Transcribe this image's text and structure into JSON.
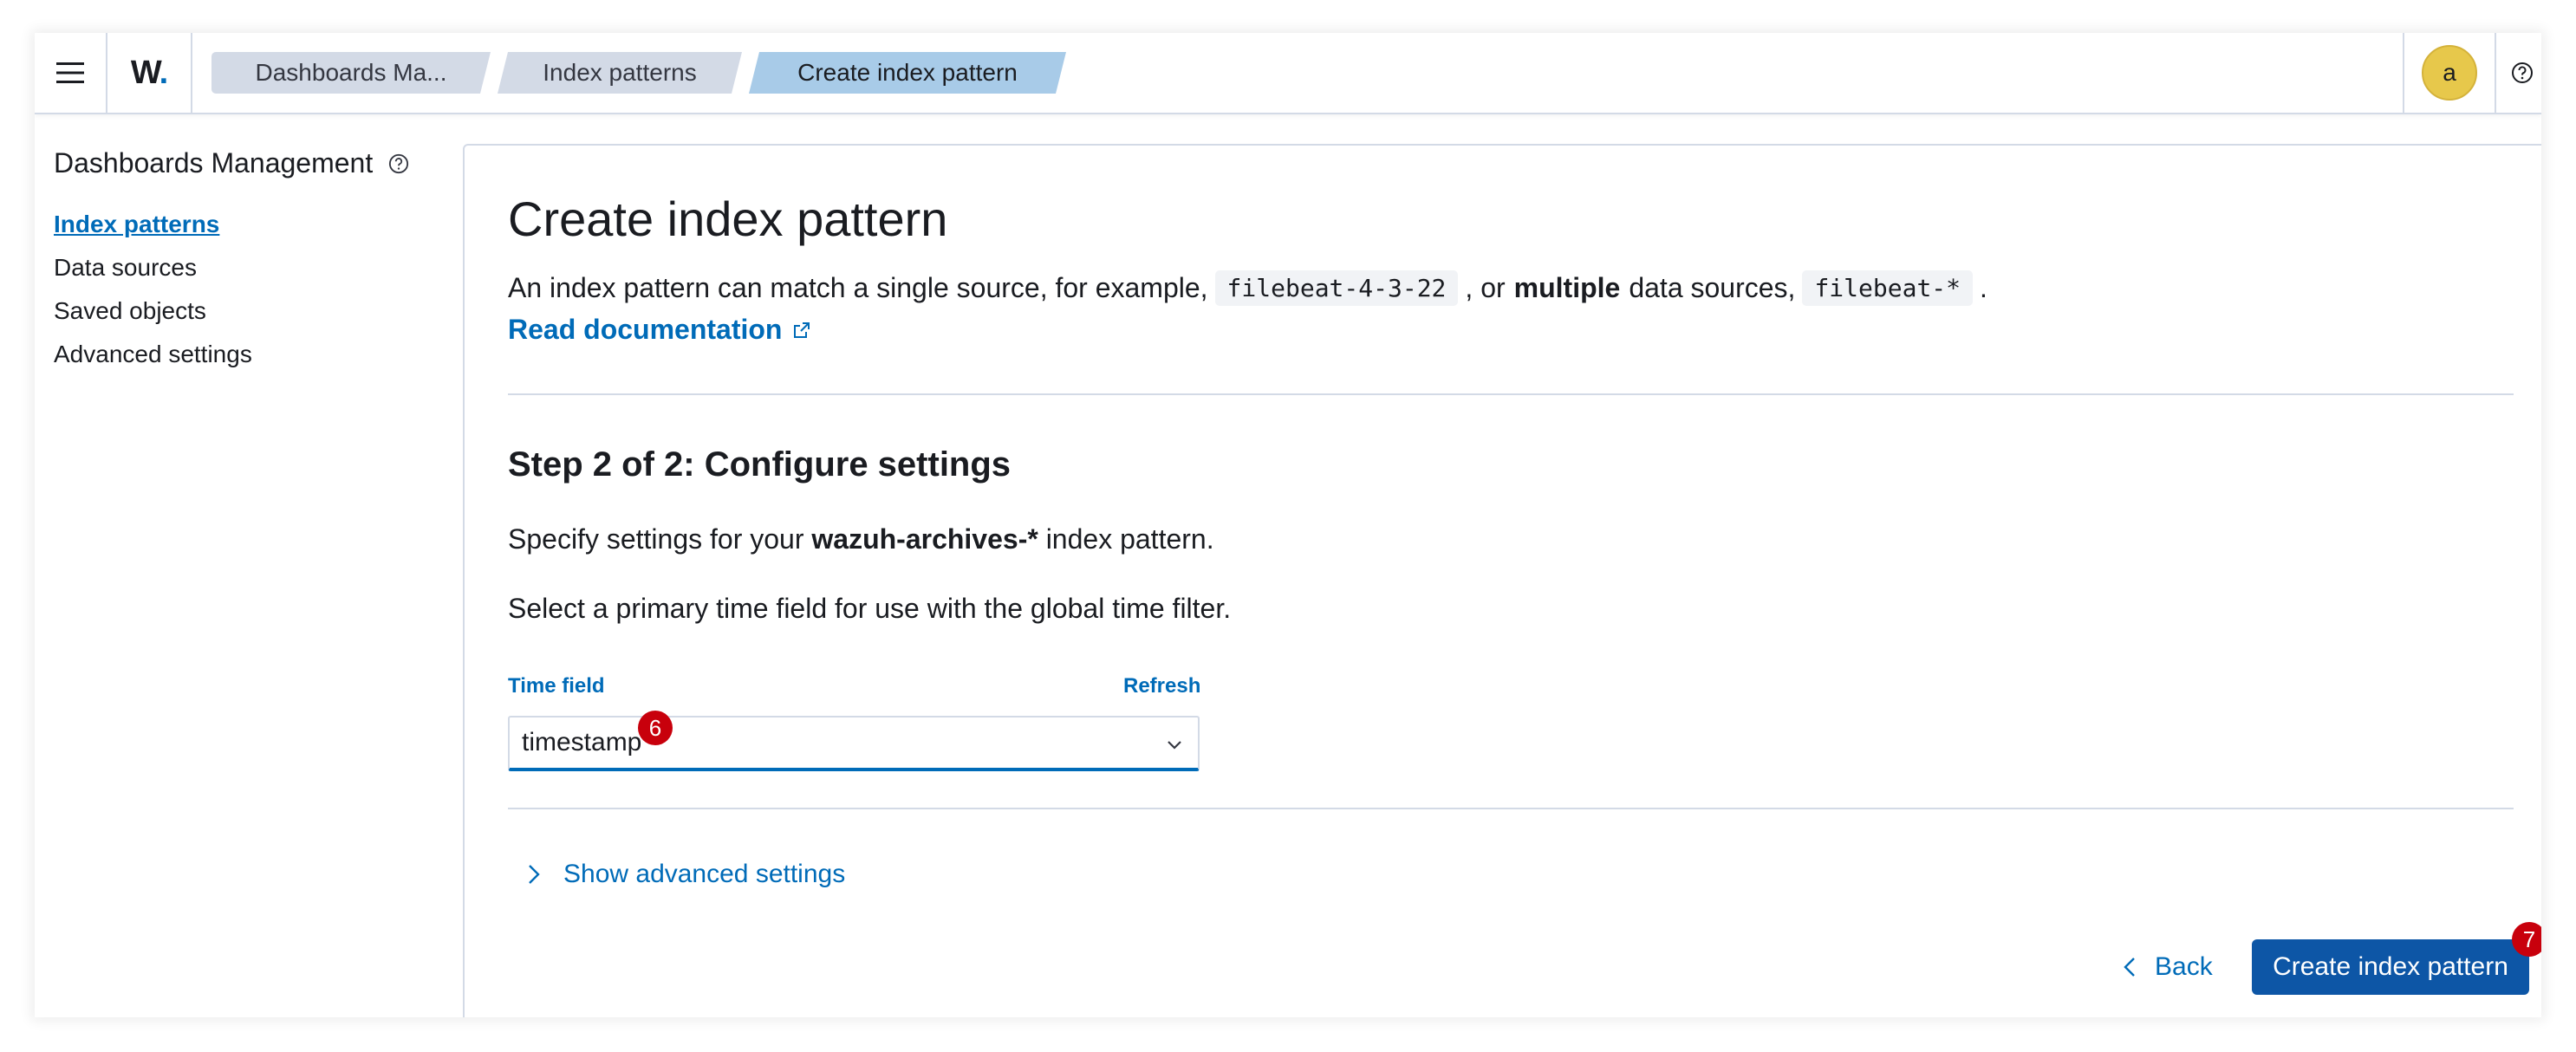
{
  "header": {
    "menu_icon": "hamburger-menu-icon",
    "logo_text": "W",
    "logo_dot": ".",
    "breadcrumbs": [
      {
        "label": "Dashboards Ma..."
      },
      {
        "label": "Index patterns"
      },
      {
        "label": "Create index pattern"
      }
    ],
    "avatar_initial": "a",
    "help_icon": "help-icon"
  },
  "sidebar": {
    "title": "Dashboards Management",
    "items": [
      {
        "label": "Index patterns",
        "active": true
      },
      {
        "label": "Data sources"
      },
      {
        "label": "Saved objects"
      },
      {
        "label": "Advanced settings"
      }
    ]
  },
  "main": {
    "title": "Create index pattern",
    "desc_part1": "An index pattern can match a single source, for example,",
    "desc_code1": "filebeat-4-3-22",
    "desc_part2": ", or",
    "desc_bold": "multiple",
    "desc_part3": "data sources,",
    "desc_code2": "filebeat-*",
    "desc_part4": ".",
    "doc_link": "Read documentation",
    "step_title": "Step 2 of 2: Configure settings",
    "spec_prefix": "Specify settings for your",
    "spec_bold": "wazuh-archives-*",
    "spec_suffix": "index pattern.",
    "select_desc": "Select a primary time field for use with the global time filter.",
    "time_field_label": "Time field",
    "refresh_label": "Refresh",
    "time_field_value": "timestamp",
    "advanced_toggle": "Show advanced settings",
    "back_label": "Back",
    "create_label": "Create index pattern"
  },
  "badges": {
    "time_field": "6",
    "create": "7"
  },
  "colors": {
    "accent": "#006bb8",
    "primary_button": "#0d56a6",
    "badge": "#c8000c",
    "avatar": "#e7c84b"
  }
}
